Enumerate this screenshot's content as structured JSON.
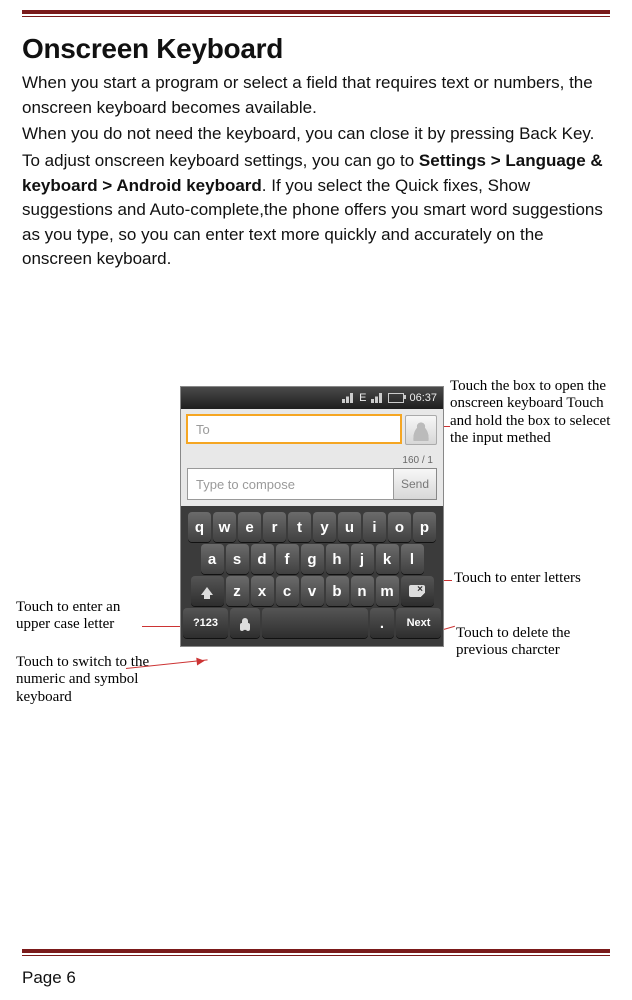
{
  "page": {
    "title": "Onscreen Keyboard",
    "para1": "When you start a program or select a field that requires text or numbers, the onscreen keyboard becomes available.",
    "para2": "When you do not need the keyboard, you can close it by pressing Back Key.",
    "para3a": "To adjust onscreen keyboard settings, you can go to ",
    "para3b": "Settings > Language & keyboard > Android keyboard",
    "para3c": ". If you select the Quick fixes, Show suggestions and Auto-complete,the phone offers you smart word suggestions as you type, so you can enter text more quickly and accurately on the onscreen keyboard.",
    "footer": "Page 6"
  },
  "phone": {
    "status_time": "06:37",
    "signal_label": "E",
    "to_placeholder": "To",
    "counter": "160 / 1",
    "compose_placeholder": "Type to compose",
    "send_label": "Send",
    "keys_row1": [
      "q",
      "w",
      "e",
      "r",
      "t",
      "y",
      "u",
      "i",
      "o",
      "p"
    ],
    "keys_row2": [
      "a",
      "s",
      "d",
      "f",
      "g",
      "h",
      "j",
      "k",
      "l"
    ],
    "keys_row3": [
      "z",
      "x",
      "c",
      "v",
      "b",
      "n",
      "m"
    ],
    "sym_label": "?123",
    "period_label": ".",
    "next_label": "Next"
  },
  "callouts": {
    "open_box": "Touch the box to open the onscreen keyboard Touch and hold the box to selecet the input methed",
    "enter_letters": "Touch to enter letters",
    "delete": "Touch to delete the previous charcter",
    "upper_case": "Touch to enter an upper case letter",
    "switch_numeric": "Touch to switch to the numeric and symbol keyboard"
  }
}
